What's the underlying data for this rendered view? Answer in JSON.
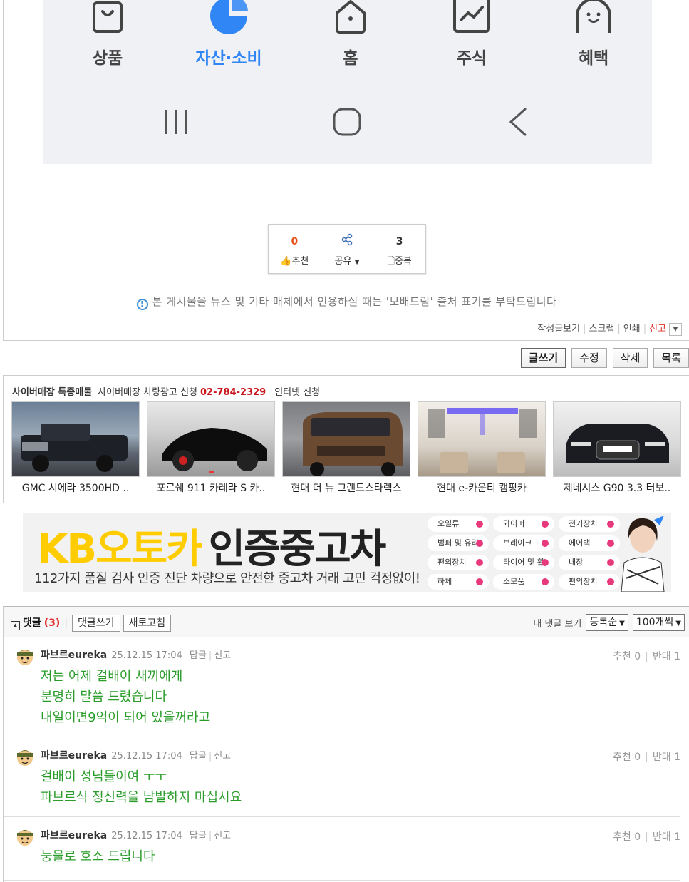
{
  "phone_nav": {
    "items": [
      {
        "label": "상품",
        "icon": "bag-icon"
      },
      {
        "label": "자산·소비",
        "icon": "pie-chart-icon",
        "active": true
      },
      {
        "label": "홈",
        "icon": "home-icon"
      },
      {
        "label": "주식",
        "icon": "stock-chart-icon"
      },
      {
        "label": "혜택",
        "icon": "benefit-face-icon"
      }
    ],
    "accent": "#2f86f4"
  },
  "vote": {
    "recommend_count": "0",
    "recommend_label": "추천",
    "share_label": "공유",
    "duplicate_count": "3",
    "duplicate_label": "중복"
  },
  "notice": "본 게시물을 뉴스 및 기타 매체에서 인용하실 때는 '보배드림' 출처 표기를 부탁드립니다",
  "post_links": {
    "view_posts": "작성글보기",
    "scrap": "스크랩",
    "print": "인쇄",
    "report": "신고"
  },
  "buttons": {
    "write": "글쓰기",
    "edit": "수정",
    "delete": "삭제",
    "list": "목록"
  },
  "cyber": {
    "title": "사이버매장 특종매물",
    "ad_text": "사이버매장 차량광고 신청",
    "phone": "02-784-2329",
    "internet_apply": "인터넷 신청",
    "cars": [
      {
        "name": "GMC 시에라 3500HD ..",
        "color": "#2a2f38"
      },
      {
        "name": "포르쉐 911 카레라 S 카..",
        "color": "#111111"
      },
      {
        "name": "현대 더 뉴 그랜드스타렉스",
        "color": "#6b4a32"
      },
      {
        "name": "현대 e-카운티 캠핑카",
        "color": "#d9d2c8"
      },
      {
        "name": "제네시스 G90 3.3 터보..",
        "color": "#1a1c22"
      }
    ]
  },
  "banner": {
    "title_yellow": "KB오토카",
    "title_black": "인증중고차",
    "subtitle": "112가지 품질 검사 인증 진단 차량으로 안전한 중고차 거래 고민 걱정없이!",
    "tags": [
      "오일류",
      "와이퍼",
      "전기장치",
      "범퍼 및 유리",
      "브레이크",
      "에어백",
      "편의장치",
      "타이어 및 휠",
      "내장",
      "하체",
      "소모품",
      "편의장치"
    ]
  },
  "comments_header": {
    "title": "댓글",
    "count": "(3)",
    "write_label": "댓글쓰기",
    "refresh_label": "새로고침",
    "my_comments": "내 댓글 보기",
    "sort_value": "등록순",
    "per_page_value": "100개씩"
  },
  "comments": [
    {
      "nick": "파브르eureka",
      "date": "25.12.15 17:04",
      "reply": "답글",
      "report": "신고",
      "recommend": "추천 0",
      "oppose": "반대 1",
      "lines": [
        "저는 어제 걸배이 새끼에게",
        "분명히 말씀 드렸습니다",
        "내일이면9억이 되어 있을꺼라고"
      ]
    },
    {
      "nick": "파브르eureka",
      "date": "25.12.15 17:04",
      "reply": "답글",
      "report": "신고",
      "recommend": "추천 0",
      "oppose": "반대 1",
      "lines": [
        "걸배이 성님들이여 ㅜㅜ",
        "파브르식 정신력을 남발하지 마십시요"
      ]
    },
    {
      "nick": "파브르eureka",
      "date": "25.12.15 17:04",
      "reply": "답글",
      "report": "신고",
      "recommend": "추천 0",
      "oppose": "반대 1",
      "lines": [
        "눙물로 호소 드립니다"
      ]
    }
  ]
}
